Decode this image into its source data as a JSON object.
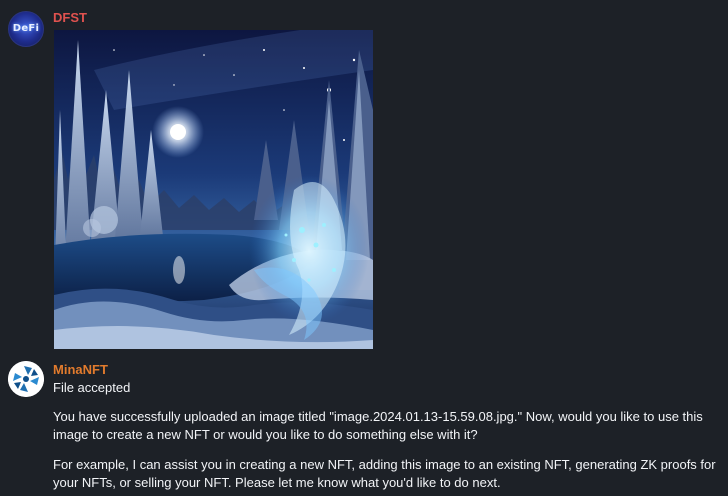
{
  "messages": [
    {
      "sender": "DFST",
      "sender_color": "#e0524f",
      "avatar_text": "DeFi",
      "attachment": {
        "type": "image",
        "description_icon": "night-forest-spirit-image"
      }
    },
    {
      "sender": "MinaNFT",
      "sender_color": "#e27b2d",
      "avatar_icon": "mina-logo-icon",
      "lines": [
        "File accepted",
        "You have successfully uploaded an image titled \"image.2024.01.13-15.59.08.jpg.\" Now, would you like to use this image to create a new NFT or would you like to do something else with it?",
        "For example, I can assist you in creating a new NFT, adding this image to an existing NFT, generating ZK proofs for your NFTs, or selling your NFT. Please let me know what you'd like to do next."
      ]
    }
  ],
  "colors": {
    "background": "#1d2127",
    "text": "#f2f4f7"
  }
}
